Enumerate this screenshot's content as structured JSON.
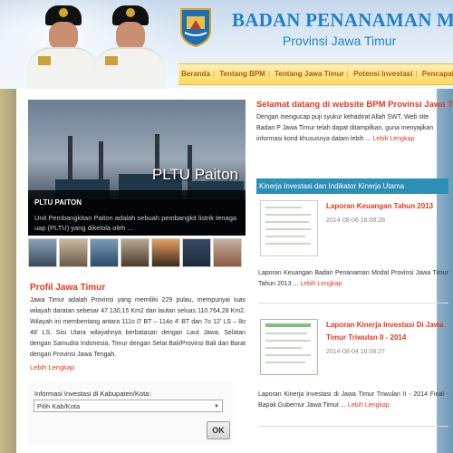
{
  "header": {
    "title": "BADAN PENANAMAN MODAL",
    "subtitle": "Provinsi Jawa Timur"
  },
  "nav": {
    "items": [
      "Beranda",
      "Tentang BPM",
      "Tentang Jawa Timur",
      "Potensi Investasi",
      "Pencapaian Kine"
    ]
  },
  "slider": {
    "image_caption": "PLTU Paiton",
    "title": "PLTU PAITON",
    "description": "Unit Pembangkitan Paiton adalah sebuah pembangkit listrik tenaga uap (PLTU) yang dikelola oleh ..."
  },
  "welcome": {
    "title": "Selamat datang di website BPM Provinsi Jawa T",
    "text": "Dengan mengucap puji syukur kehadirat Allah SWT, Web site Badan P Jawa Timur telah dapat ditampilkan, guna menyajikan informasi kond khususnya dalam lebih ...",
    "more": "Lebih Lengkap"
  },
  "kinerja": {
    "header": "Kinerja Investasi dan Indikator Kinerja Utama",
    "items": [
      {
        "title": "Laporan Keuangan Tahun 2013",
        "date": "2014-08-06 16:08:28",
        "summary": "Laporan Keuangan Badan Penanaman Modal Provinsi Jawa Timur Tahun 2013 ...",
        "more": "Lebih Lengkap"
      },
      {
        "title": "Laporan Kinerja Investasi Di Jawa Timur Triwulan II - 2014",
        "date": "2014-08-04 16:08:27",
        "summary": "Laporan Kinerja Investasi di Jawa Timur Triwulan II - 2014 Final - Bapak Gubernur Jawa Timur ...",
        "more": "Lebih Lengkap"
      }
    ]
  },
  "profil": {
    "title": "Profil Jawa Timur",
    "text": "Jawa Timur adalah Provinsi yang memiliki 229 pulau, mempunyai luas wilayah daratan sebesar 47.130,15 Km2 dan lautan seluas 110.764,28 Km2. Wilayah ini membentang antara 111o 0' BT – 114o 4' BT dan 7o 12' LS – 8o 48' LS. Sisi Utara wilayahnya berbatasan dengan Laut Jawa, Selatan dengan Samudra Indonesia, Timur dengan Selat Bali/Provinsi Bali dan Barat dengan Provinsi Jawa Tengah.",
    "more": "Lebih Lengkap"
  },
  "form": {
    "label": "Informasi Investasi di Kabupaten/Kota:",
    "selected": "Pilih Kab/Kota",
    "ok_label": "OK"
  },
  "colors": {
    "accent_red": "#e5371f",
    "brand_blue": "#1c82c6",
    "nav_yellow": "#ffd860",
    "panel_teal": "#2b8fb8"
  }
}
